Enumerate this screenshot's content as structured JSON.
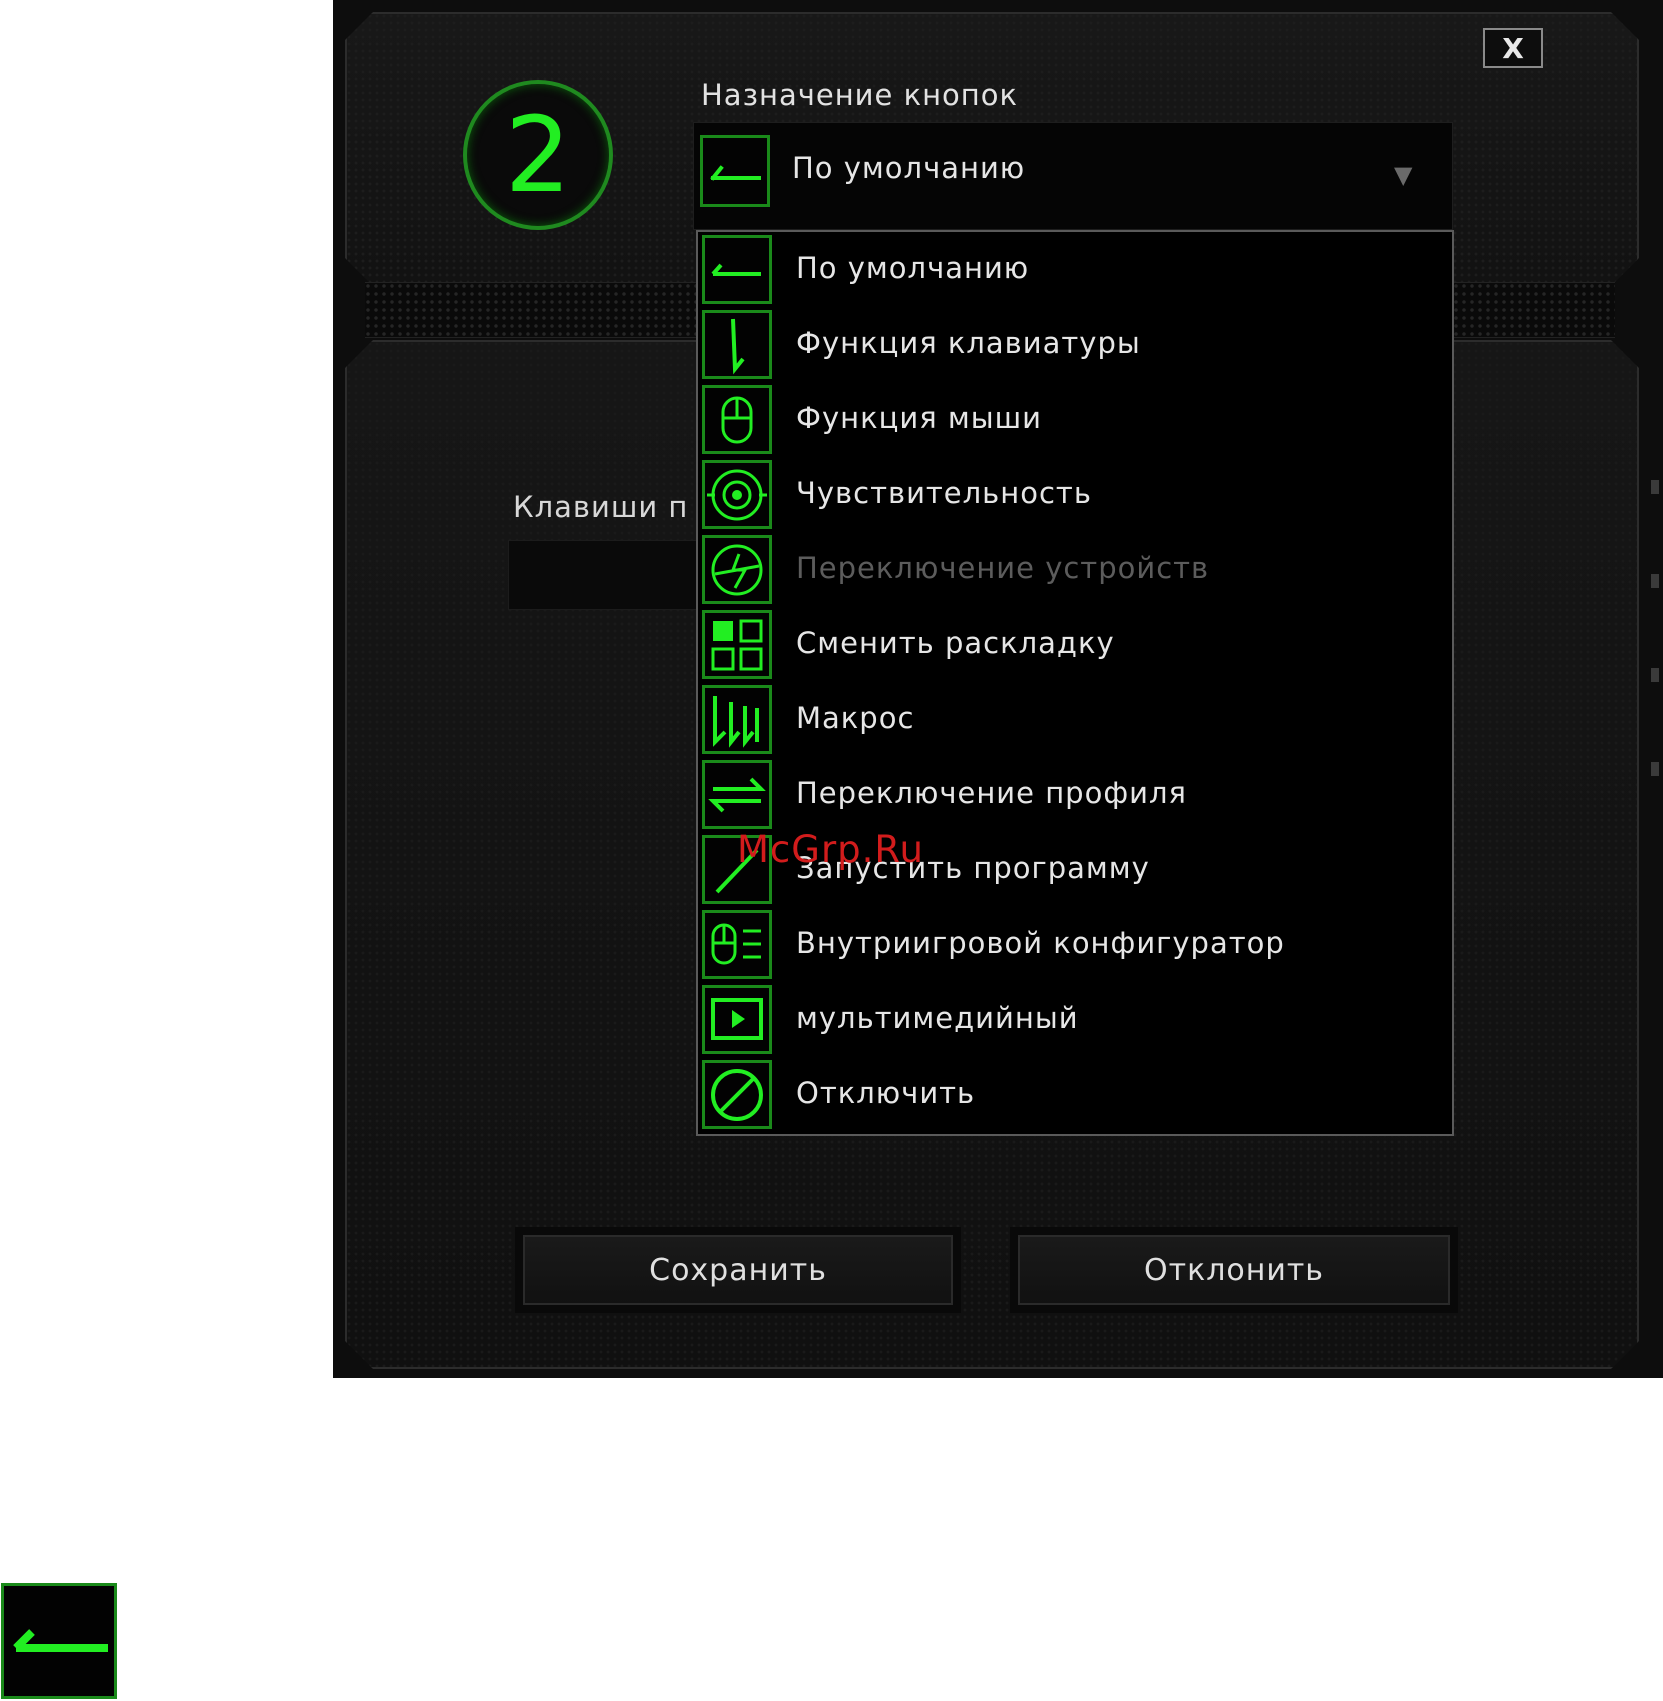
{
  "dialog": {
    "close_label": "X",
    "badge_number": "2",
    "assignment_label": "Назначение кнопок",
    "selected_value": "По умолчанию",
    "caret": "▼",
    "keys_label": "Клавиши п"
  },
  "menu": {
    "items": [
      {
        "label": "По умолчанию",
        "icon": "default-arrow-icon",
        "disabled": false
      },
      {
        "label": "Функция клавиатуры",
        "icon": "keyboard-function-icon",
        "disabled": false
      },
      {
        "label": "Функция мыши",
        "icon": "mouse-icon",
        "disabled": false
      },
      {
        "label": "Чувствительность",
        "icon": "sensitivity-target-icon",
        "disabled": false
      },
      {
        "label": "Переключение устройств",
        "icon": "device-switch-icon",
        "disabled": true
      },
      {
        "label": "Сменить раскладку",
        "icon": "layout-grid-icon",
        "disabled": false
      },
      {
        "label": "Макрос",
        "icon": "macro-icon",
        "disabled": false
      },
      {
        "label": "Переключение профиля",
        "icon": "profile-switch-icon",
        "disabled": false
      },
      {
        "label": "Запустить программу",
        "icon": "launch-program-icon",
        "disabled": false
      },
      {
        "label": "Внутриигровой конфигуратор",
        "icon": "ingame-config-icon",
        "disabled": false
      },
      {
        "label": "мультимедийный",
        "icon": "multimedia-play-icon",
        "disabled": false
      },
      {
        "label": "Отключить",
        "icon": "disable-icon",
        "disabled": false
      }
    ]
  },
  "buttons": {
    "save": "Сохранить",
    "cancel": "Отклонить"
  },
  "watermark": "McGrp.Ru",
  "colors": {
    "accent_green": "#22ee22",
    "icon_border_green": "#1a8a1a",
    "watermark_red": "#d21c1c"
  }
}
